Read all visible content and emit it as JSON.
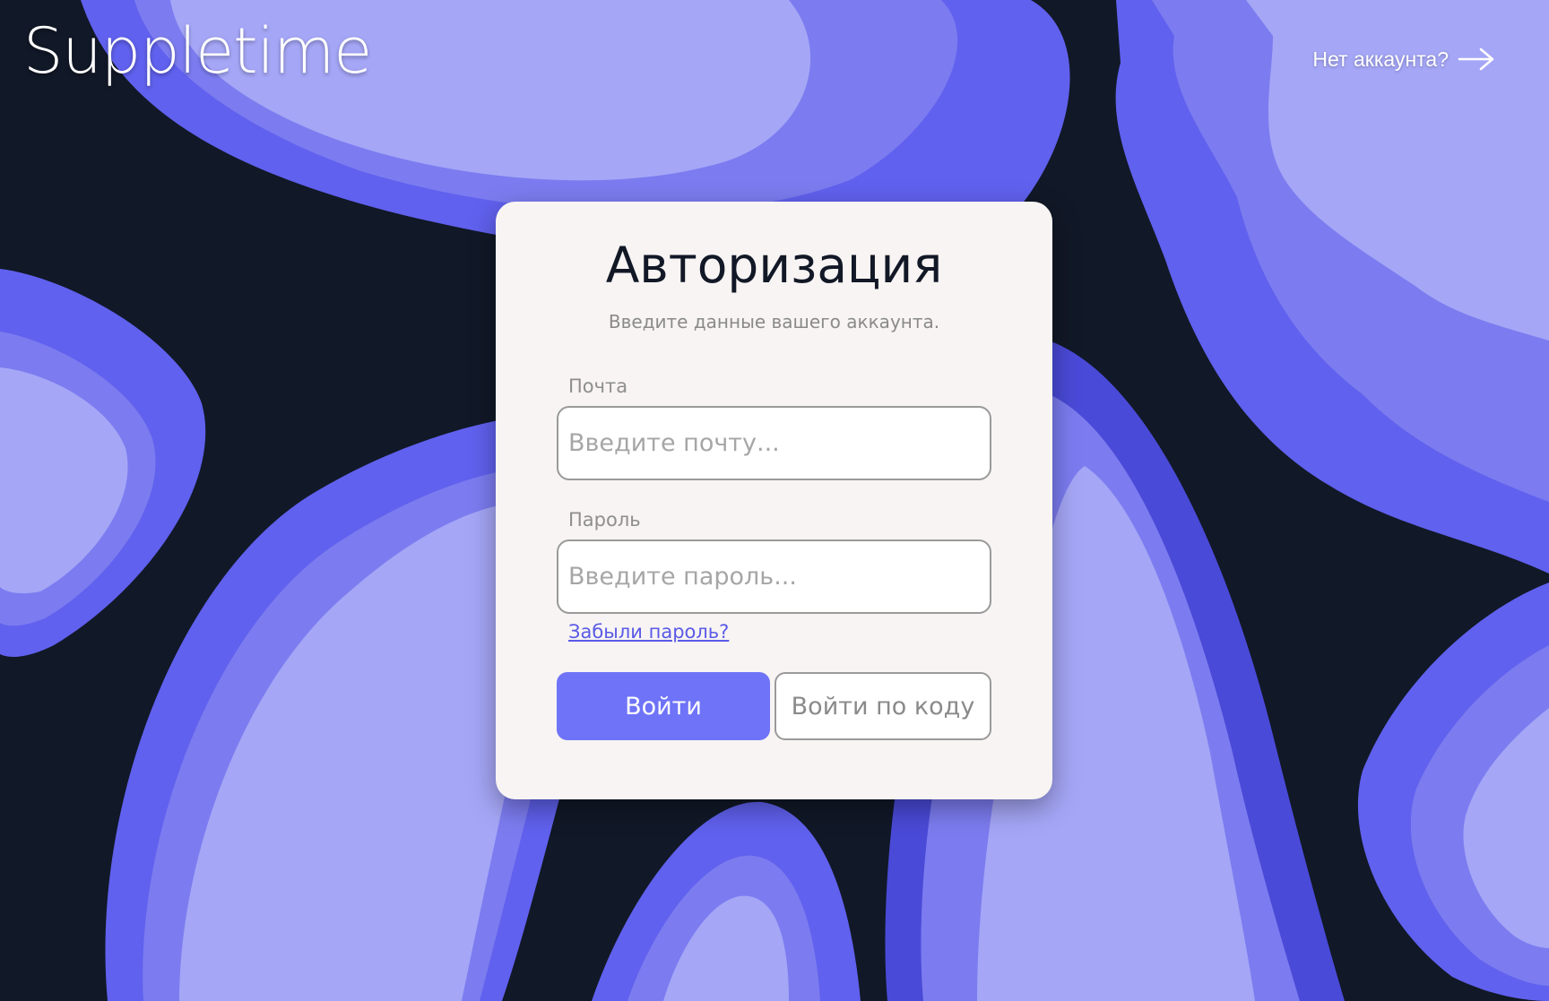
{
  "brand": {
    "logo_text": "Suppletime"
  },
  "header": {
    "signup_link_label": "Нет аккаунта?"
  },
  "login_card": {
    "title": "Авторизация",
    "subtitle": "Введите данные вашего аккаунта.",
    "email": {
      "label": "Почта",
      "value": "",
      "placeholder": "Введите почту..."
    },
    "password": {
      "label": "Пароль",
      "value": "",
      "placeholder": "Введите пароль..."
    },
    "forgot_password_label": "Забыли пароль?",
    "login_button_label": "Войти",
    "login_by_code_button_label": "Войти по коду"
  },
  "icons": {
    "signup_arrow": "arrow-right-icon"
  },
  "colors": {
    "background_dark": "#111827",
    "blob_light": "#a5a6f6",
    "blob_mid": "#7c7cf0",
    "blob_deep": "#6061ee",
    "card_bg": "#f7f4f3",
    "primary_button": "#6e73f7",
    "link": "#5a5ae6"
  }
}
